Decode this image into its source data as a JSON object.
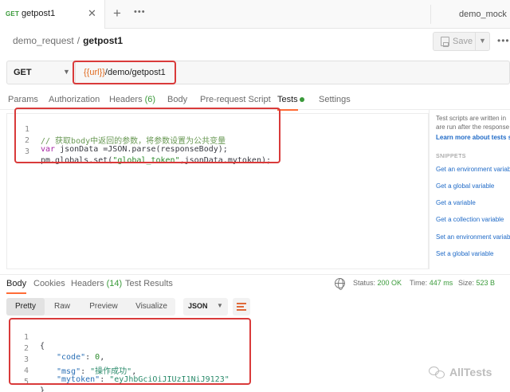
{
  "tab_bar": {
    "active_tab_method": "GET",
    "active_tab_name": "getpost1",
    "environment": "demo_mock"
  },
  "breadcrumb": {
    "parent": "demo_request",
    "separator": "/",
    "current": "getpost1"
  },
  "toolbar": {
    "save_label": "Save"
  },
  "request": {
    "method": "GET",
    "url_variable": "{{url}}",
    "url_path": "/demo/getpost1"
  },
  "request_tabs": [
    {
      "label": "Params"
    },
    {
      "label": "Authorization"
    },
    {
      "label": "Headers",
      "count": "(6)"
    },
    {
      "label": "Body"
    },
    {
      "label": "Pre-request Script"
    },
    {
      "label": "Tests",
      "active": true
    },
    {
      "label": "Settings"
    }
  ],
  "tests_script": {
    "lines": [
      {
        "n": "1",
        "comment": "// 获取body中返回的参数，将参数设置为公共变量"
      },
      {
        "n": "2",
        "kw": "var",
        "rest": " jsonData =JSON.parse(responseBody);"
      },
      {
        "n": "3",
        "obj": "pm.globals.set(",
        "str": "\"global_token\"",
        "tail": ",jsonData.mytoken);"
      }
    ]
  },
  "side_panel": {
    "note_line1": "Test scripts are written in",
    "note_line2": "are run after the response",
    "learn_link": "Learn more about tests sc",
    "snippets_heading": "SNIPPETS",
    "snippets": [
      "Get an environment variab",
      "Get a global variable",
      "Get a variable",
      "Get a collection variable",
      "Set an environment variab",
      "Set a global variable"
    ]
  },
  "response_tabs": [
    {
      "label": "Body",
      "active": true
    },
    {
      "label": "Cookies"
    },
    {
      "label": "Headers",
      "count": "(14)"
    },
    {
      "label": "Test Results"
    }
  ],
  "response_meta": {
    "status_label": "Status:",
    "status_value": "200 OK",
    "time_label": "Time:",
    "time_value": "447 ms",
    "size_label": "Size:",
    "size_value": "523 B"
  },
  "format_bar": {
    "options": [
      "Pretty",
      "Raw",
      "Preview",
      "Visualize"
    ],
    "active": "Pretty",
    "language": "JSON"
  },
  "response_body": {
    "lines": [
      {
        "n": "1",
        "text": "{"
      },
      {
        "n": "2",
        "key": "\"code\"",
        "value": "0",
        "trail": ","
      },
      {
        "n": "3",
        "key": "\"msg\"",
        "value": "\"操作成功\"",
        "trail": ","
      },
      {
        "n": "4",
        "key": "\"mytoken\"",
        "value": "\"eyJhbGciOiJIUzI1NiJ9123\"",
        "trail": ""
      },
      {
        "n": "5",
        "text": "}"
      }
    ]
  },
  "watermark": {
    "text": "AllTests"
  },
  "colors": {
    "accent": "#ff6c37",
    "highlight_box": "#d93a3a",
    "status_ok": "#3a9a3a",
    "url_variable": "#e16a1e"
  }
}
